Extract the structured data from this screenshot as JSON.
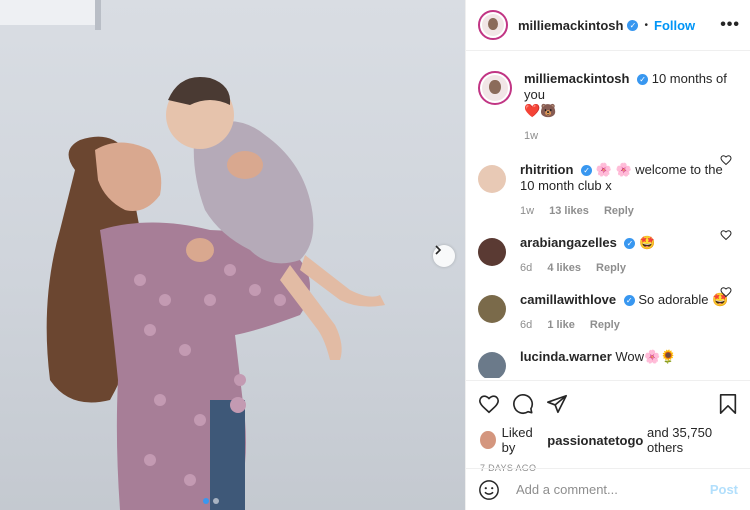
{
  "header": {
    "username": "milliemackintosh",
    "follow_label": "Follow",
    "more_label": "•••"
  },
  "caption": {
    "username": "milliemackintosh",
    "text": "10 months of you",
    "emoji": "❤️🐻",
    "time": "1w"
  },
  "comments": [
    {
      "username": "rhitrition",
      "text": "🌸 🌸 welcome to the 10 month club x",
      "time": "1w",
      "likes": "13 likes",
      "reply": "Reply",
      "avatar_color": "#e8c9b5"
    },
    {
      "username": "arabiangazelles",
      "text": "🤩",
      "time": "6d",
      "likes": "4 likes",
      "reply": "Reply",
      "avatar_color": "#5a3a33"
    },
    {
      "username": "camillawithlove",
      "text": "So adorable 🤩",
      "time": "6d",
      "likes": "1 like",
      "reply": "Reply",
      "avatar_color": "#7a6a4a"
    },
    {
      "username": "lucinda.warner",
      "text": "Wow🌸🌻",
      "time": "",
      "likes": "",
      "reply": "",
      "avatar_color": "#6b7a8a"
    }
  ],
  "likes": {
    "prefix": "Liked by",
    "user": "passionatetogo",
    "suffix": "and 35,750 others"
  },
  "date": "7 DAYS AGO",
  "add_comment": {
    "placeholder": "Add a comment...",
    "post_label": "Post"
  },
  "colors": {
    "accent": "#0095f6",
    "verified": "#3897f0",
    "muted": "#8e8e8e"
  }
}
